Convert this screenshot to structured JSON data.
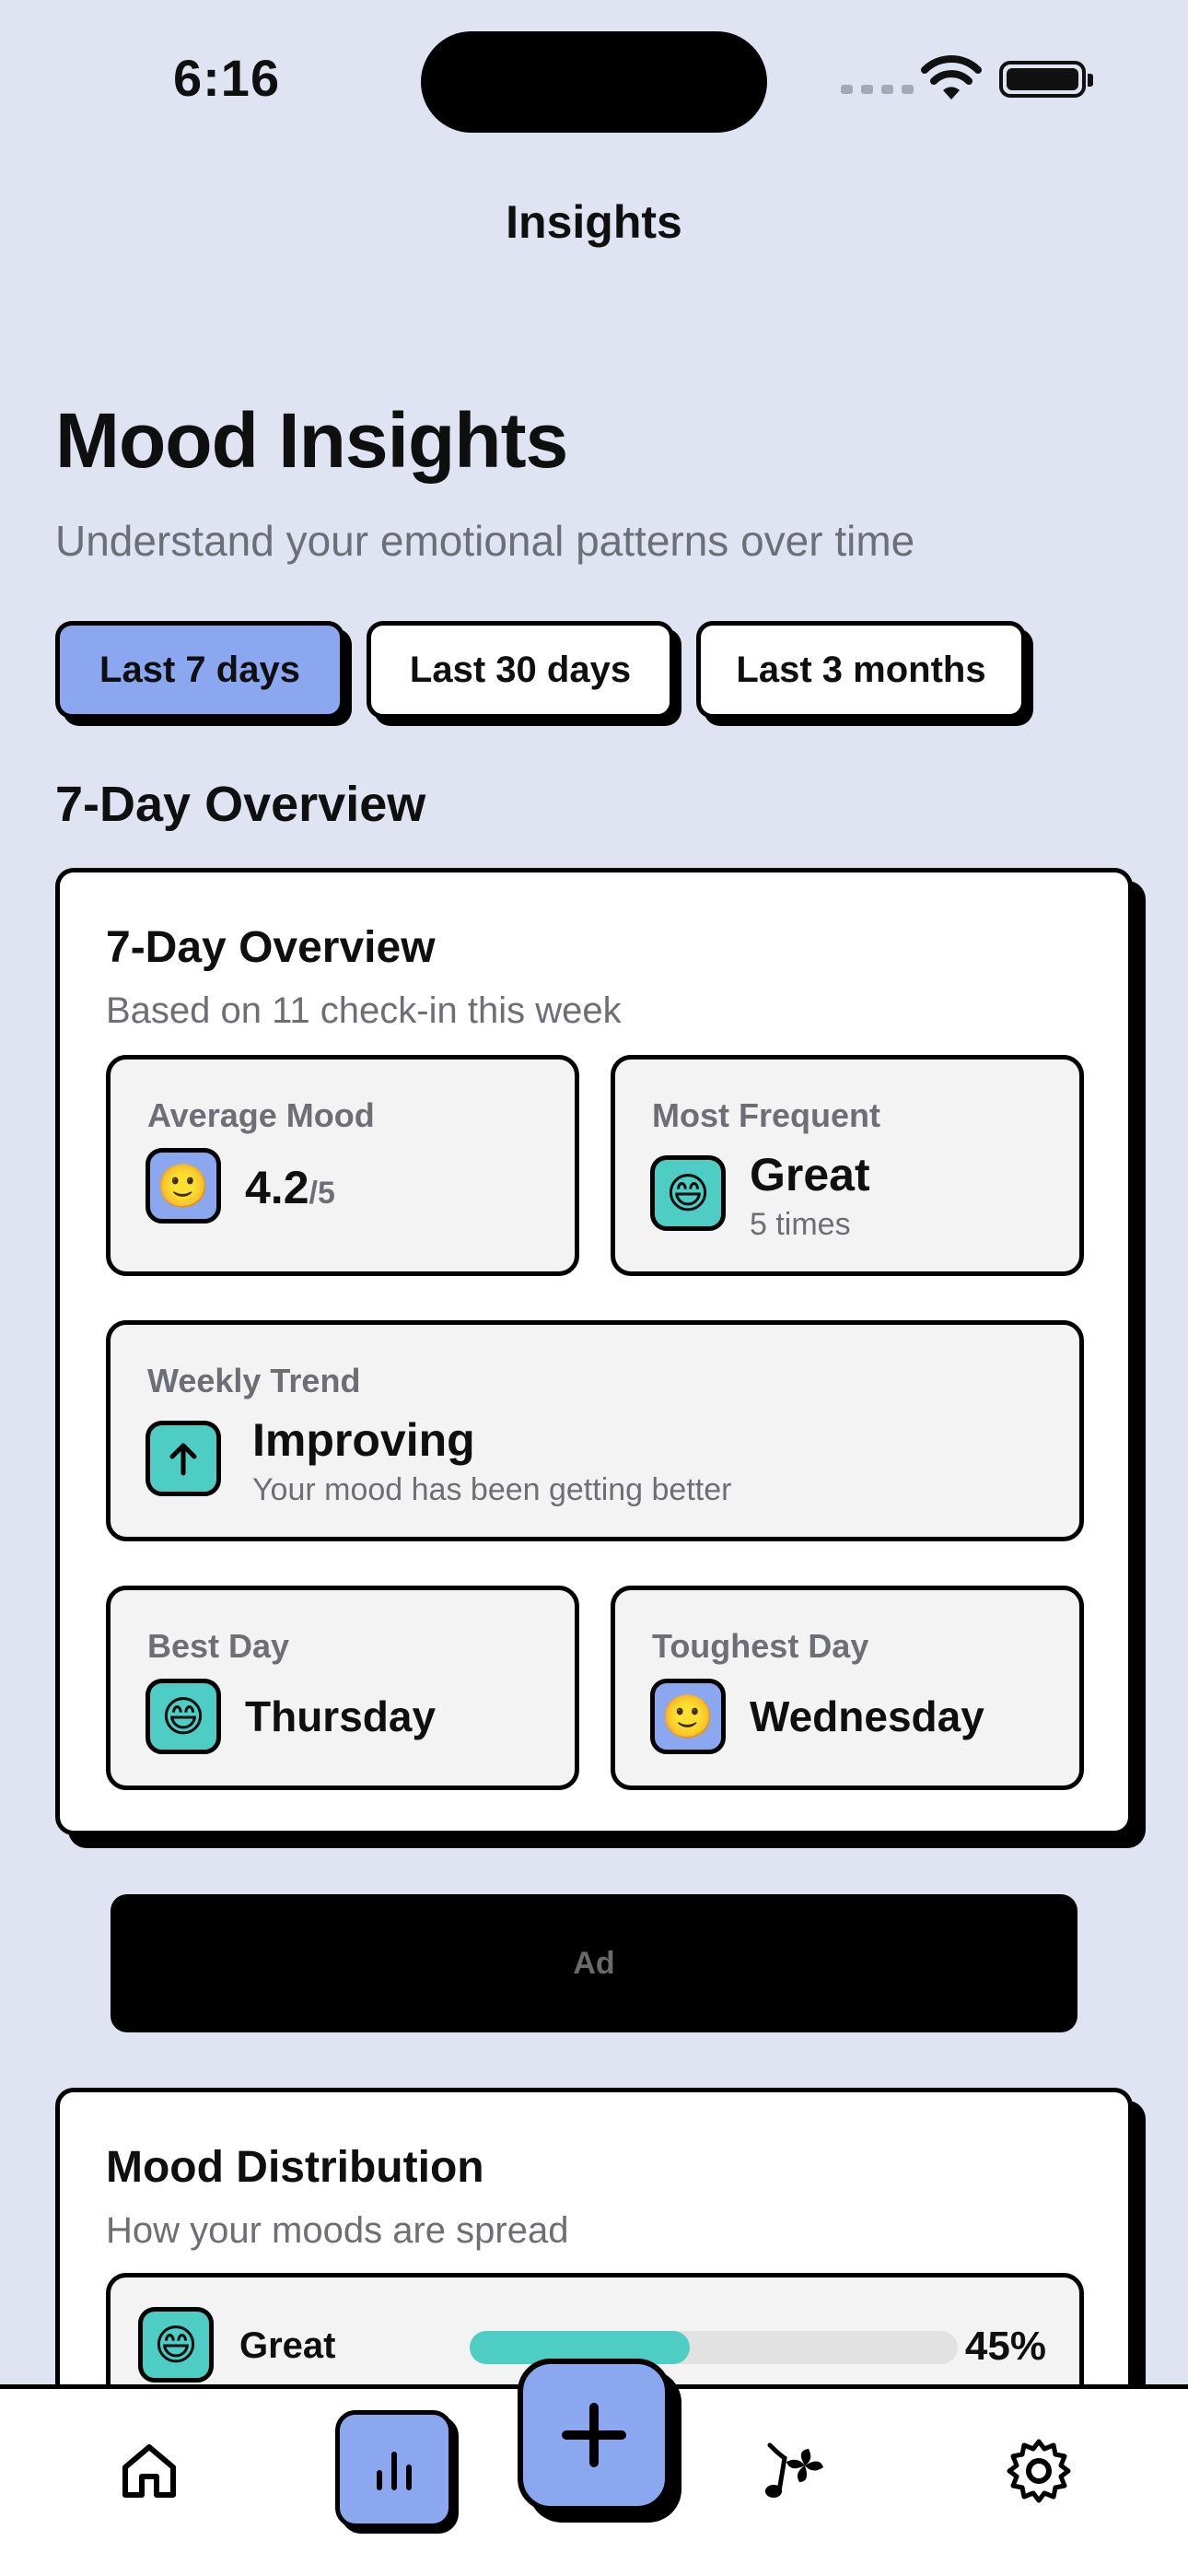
{
  "status_bar": {
    "time": "6:16"
  },
  "nav": {
    "title": "Insights"
  },
  "header": {
    "title": "Mood Insights",
    "subtitle": "Understand your emotional patterns over time"
  },
  "range_chips": [
    {
      "label": "Last 7 days",
      "active": true
    },
    {
      "label": "Last 30 days",
      "active": false
    },
    {
      "label": "Last 3 months",
      "active": false
    }
  ],
  "section_heading": "7-Day Overview",
  "overview": {
    "title": "7-Day Overview",
    "subtitle": "Based on 11 check-in this week",
    "average_mood": {
      "label": "Average Mood",
      "emoji": "🙂",
      "value": "4.2",
      "suffix": "/5"
    },
    "most_frequent": {
      "label": "Most Frequent",
      "emoji": "😄",
      "value": "Great",
      "note": "5 times"
    },
    "weekly_trend": {
      "label": "Weekly Trend",
      "icon": "arrow-up-icon",
      "value": "Improving",
      "note": "Your mood has been getting better"
    },
    "best_day": {
      "label": "Best Day",
      "emoji": "😄",
      "value": "Thursday"
    },
    "toughest_day": {
      "label": "Toughest Day",
      "emoji": "🙂",
      "value": "Wednesday"
    }
  },
  "ad": {
    "label": "Ad"
  },
  "distribution": {
    "title": "Mood Distribution",
    "subtitle": "How your moods are spread",
    "rows": [
      {
        "emoji": "😄",
        "label": "Great",
        "percent": 45,
        "percent_label": "45%"
      }
    ]
  },
  "tabbar": {
    "items": [
      "home-icon",
      "insights-icon",
      "add-icon",
      "music-wellness-icon",
      "settings-icon"
    ],
    "fab_symbol": "+"
  },
  "colors": {
    "background": "#e0e4f2",
    "accent_blue": "#8aa7f0",
    "accent_teal": "#4ecdc4"
  }
}
